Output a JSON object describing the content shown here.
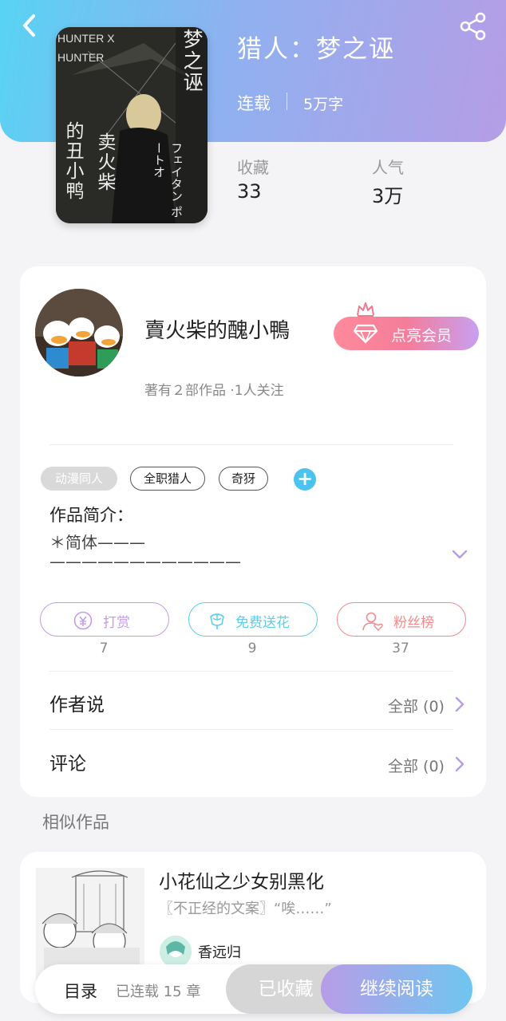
{
  "header": {
    "book_title": "猎人：梦之诬",
    "status": "连载",
    "word_count": "5万字",
    "stats": [
      {
        "label": "收藏",
        "value": "33"
      },
      {
        "label": "人气",
        "value": "3万"
      }
    ],
    "cover_text": {
      "series": "HUNTER X HUNTER",
      "vertical_1": "梦之诬",
      "vertical_2": "卖火柴",
      "vertical_3": "的丑小鸭",
      "vertical_4": "フェイタン ポートオ"
    }
  },
  "author": {
    "name": "賣火柴的醜小鴨",
    "meta": "著有２部作品 ·1人关注",
    "vip_label": "点亮会员"
  },
  "tags": [
    "动漫同人",
    "全职猎人",
    "奇犽"
  ],
  "intro": {
    "label": "作品简介：",
    "text": "＊简体———\n————————————"
  },
  "actions": [
    {
      "label": "打赏",
      "count": "7",
      "color": "#c49be6"
    },
    {
      "label": "免费送花",
      "count": "9",
      "color": "#5ccdea"
    },
    {
      "label": "粉丝榜",
      "count": "37",
      "color": "#f08a8e"
    }
  ],
  "rows": [
    {
      "label": "作者说",
      "value": "全部 (0)"
    },
    {
      "label": "评论",
      "value": "全部 (0)"
    }
  ],
  "similar": {
    "section_title": "相似作品",
    "items": [
      {
        "title": "小花仙之少女别黑化",
        "desc": "〖不正经的文案〗“唉……”",
        "author": "香远归"
      }
    ]
  },
  "bottom_bar": {
    "catalog": "目录",
    "catalog_sub": "已连载 15 章",
    "fav_label": "已收藏",
    "read_label": "继续阅读"
  },
  "colors": {
    "accent_purple": "#b59de6",
    "accent_blue": "#58d3f3"
  }
}
